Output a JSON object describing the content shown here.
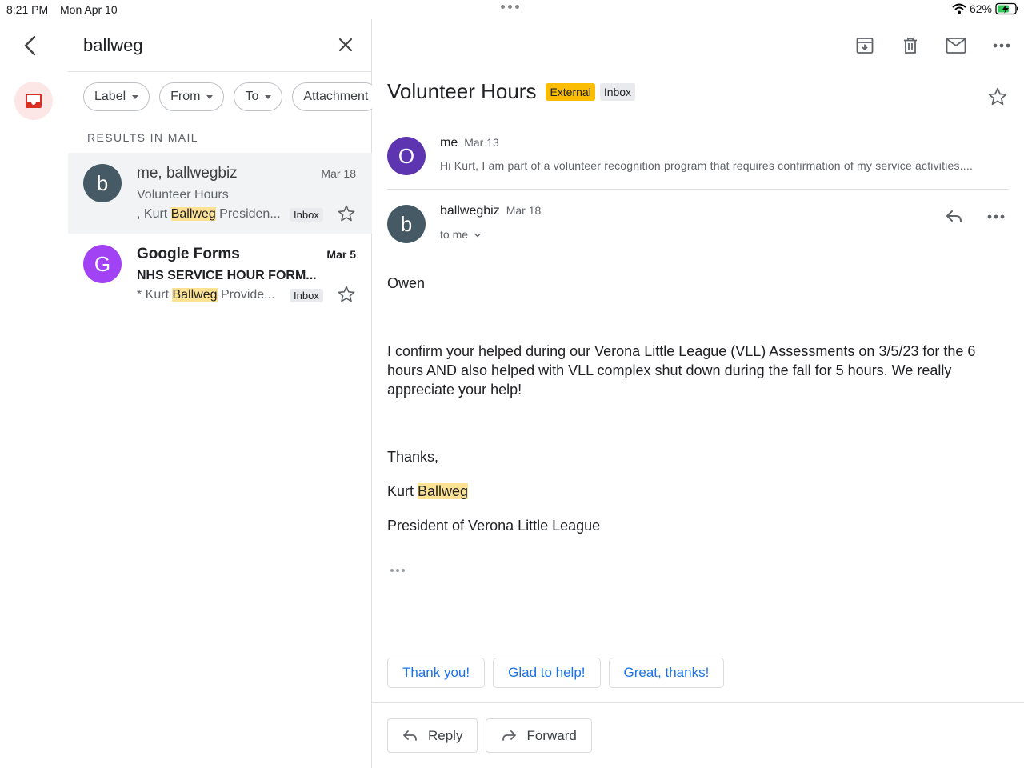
{
  "status_bar": {
    "time": "8:21 PM",
    "date": "Mon Apr 10",
    "battery": "62%"
  },
  "search": {
    "query": "ballweg"
  },
  "filters": [
    "Label",
    "From",
    "To",
    "Attachment"
  ],
  "results_label": "RESULTS IN MAIL",
  "results": [
    {
      "avatar_letter": "b",
      "avatar_color": "#455a64",
      "sender": "me, ballwegbiz",
      "date": "Mar 18",
      "subject": "Volunteer Hours",
      "snippet_pre": ", Kurt ",
      "snippet_hl": "Ballweg",
      "snippet_post": " Presiden...",
      "tag": "Inbox"
    },
    {
      "avatar_letter": "G",
      "avatar_color": "#a142f4",
      "sender": "Google Forms",
      "date": "Mar 5",
      "subject": "NHS SERVICE HOUR FORM...",
      "snippet_pre": "* Kurt ",
      "snippet_hl": "Ballweg",
      "snippet_post": " Provide...",
      "tag": "Inbox"
    }
  ],
  "thread": {
    "subject": "Volunteer Hours",
    "tag_external": "External",
    "tag_inbox": "Inbox",
    "collapsed_message": {
      "avatar_letter": "O",
      "from": "me",
      "date": "Mar 13",
      "preview": "Hi Kurt, I am part of a volunteer recognition program that requires confirmation of my service activities...."
    },
    "open_message": {
      "avatar_letter": "b",
      "from": "ballwegbiz",
      "date": "Mar 18",
      "to": "to me",
      "greeting": "Owen",
      "body": "I confirm your helped during our Verona Little League (VLL) Assessments on 3/5/23 for the 6 hours AND also helped with VLL complex shut down during the fall for 5 hours. We really appreciate your help!",
      "closing": "Thanks,",
      "signature_pre": "Kurt ",
      "signature_hl": "Ballweg",
      "signature_title": "President of Verona Little League"
    }
  },
  "smart_replies": [
    "Thank you!",
    "Glad to help!",
    "Great, thanks!"
  ],
  "actions": {
    "reply": "Reply",
    "forward": "Forward"
  },
  "colors": {
    "accent": "#1a73e8",
    "external_tag": "#fbbc04",
    "highlight": "#fde293",
    "inbox_rail": "#d93025"
  }
}
